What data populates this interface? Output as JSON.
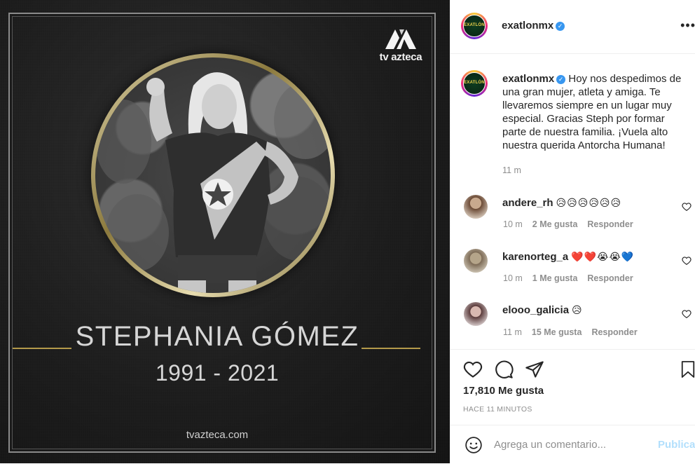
{
  "image": {
    "brand_text": "tv azteca",
    "name": "STEPHANIA GÓMEZ",
    "years": "1991 - 2021",
    "url": "tvazteca.com"
  },
  "header": {
    "username": "exatlonmx",
    "avatar_text": "EXATLÓN"
  },
  "caption": {
    "username": "exatlonmx",
    "text": "Hoy nos despedimos de una gran mujer, atleta y amiga. Te llevaremos siempre en un lugar muy especial. Gracias Steph por formar parte de nuestra familia. ¡Vuela alto nuestra querida Antorcha Humana!",
    "time": "11 m"
  },
  "comments": [
    {
      "username": "andere_rh",
      "emoji": "😥😥😥😥😥😥",
      "time": "10 m",
      "likes": "2 Me gusta",
      "reply": "Responder"
    },
    {
      "username": "karenorteg_a",
      "emoji": "❤️❤️😭😭💙",
      "time": "10 m",
      "likes": "1 Me gusta",
      "reply": "Responder"
    },
    {
      "username": "elooo_galicia",
      "emoji": "😥",
      "time": "11 m",
      "likes": "15 Me gusta",
      "reply": "Responder"
    }
  ],
  "stats": {
    "likes": "17,810 Me gusta",
    "posted": "HACE 11 MINUTOS"
  },
  "add_comment": {
    "placeholder": "Agrega un comentario...",
    "publish": "Publicar"
  },
  "colors": {
    "accent_gold": "#b49a4a",
    "link_disabled": "#b2dffc",
    "verified": "#3897f0"
  }
}
